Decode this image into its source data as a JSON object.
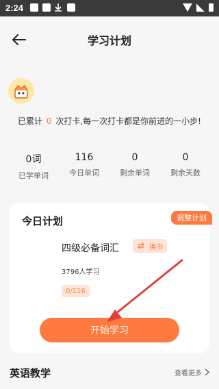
{
  "status_bar": {
    "time": "2:24"
  },
  "nav": {
    "title": "学习计划"
  },
  "streak": {
    "prefix": "已累计",
    "days": "0",
    "suffix": "次打卡,每一次打卡都是你前进的一小步!"
  },
  "stats": [
    {
      "value": "0词",
      "label": "已学单词"
    },
    {
      "value": "116",
      "label": "今日单词"
    },
    {
      "value": "0",
      "label": "剩余单词"
    },
    {
      "value": "0",
      "label": "剩余天数"
    }
  ],
  "plan": {
    "title": "今日计划",
    "adjust_label": "调整计划",
    "book": "四级必备词汇",
    "swap_label": "换书",
    "learners": "3796人学习",
    "progress": "0/116",
    "start_label": "开始学习"
  },
  "section": {
    "title": "英语教学",
    "more_label": "查看更多"
  },
  "icons": {
    "back": "arrow-left-icon",
    "swap": "swap-icon",
    "chevron": "chevron-right-icon",
    "avatar": "mascot-avatar-icon"
  },
  "colors": {
    "accent": "#ff7a3e",
    "badge_bg": "#fde4d8",
    "avatar_bg": "#ffe7a8"
  }
}
